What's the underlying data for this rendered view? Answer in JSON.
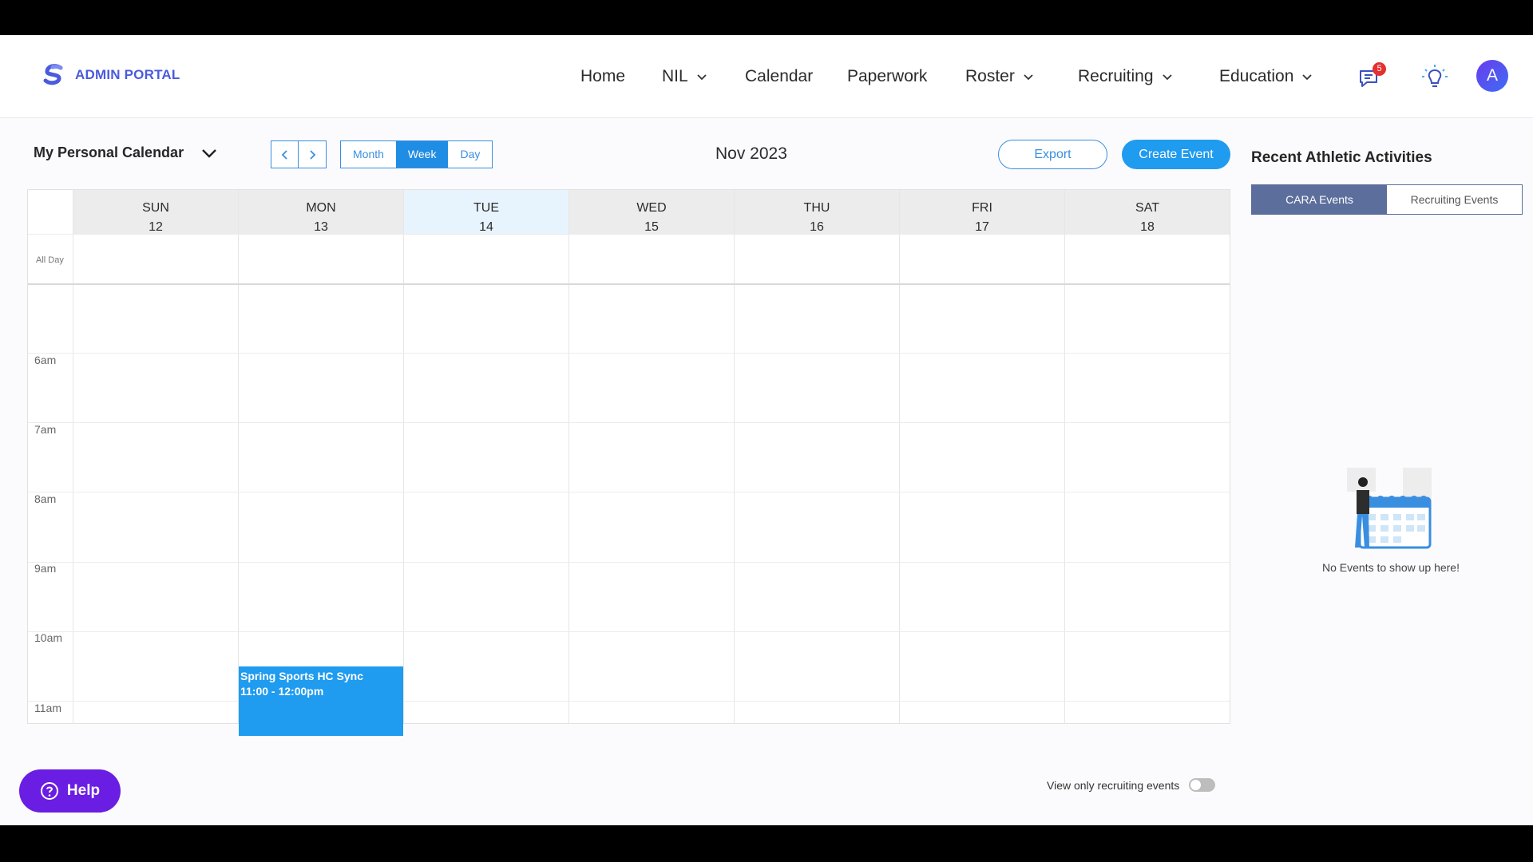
{
  "header": {
    "brand": "ADMIN PORTAL",
    "nav": [
      {
        "label": "Home",
        "dropdown": false
      },
      {
        "label": "NIL",
        "dropdown": true
      },
      {
        "label": "Calendar",
        "dropdown": false
      },
      {
        "label": "Paperwork",
        "dropdown": false
      },
      {
        "label": "Roster",
        "dropdown": true
      },
      {
        "label": "Recruiting",
        "dropdown": true
      },
      {
        "label": "Education",
        "dropdown": true
      }
    ],
    "messages_badge": "5",
    "avatar_initial": "A"
  },
  "toolbar": {
    "calendar_select": "My Personal Calendar",
    "views": [
      "Month",
      "Week",
      "Day"
    ],
    "active_view": "Week",
    "month_label": "Nov 2023",
    "export_label": "Export",
    "create_label": "Create Event"
  },
  "calendar": {
    "all_day_label": "All Day",
    "days": [
      {
        "name": "SUN",
        "date": "12"
      },
      {
        "name": "MON",
        "date": "13"
      },
      {
        "name": "TUE",
        "date": "14",
        "today": true
      },
      {
        "name": "WED",
        "date": "15"
      },
      {
        "name": "THU",
        "date": "16"
      },
      {
        "name": "FRI",
        "date": "17"
      },
      {
        "name": "SAT",
        "date": "18"
      }
    ],
    "times": [
      "6am",
      "7am",
      "8am",
      "9am",
      "10am",
      "11am"
    ],
    "event": {
      "title": "Spring Sports HC Sync",
      "time": "11:00 - 12:00pm"
    }
  },
  "footer": {
    "help_label": "Help",
    "toggle_label": "View only recruiting events"
  },
  "panel": {
    "title": "Recent Athletic Activities",
    "tabs": [
      "CARA Events",
      "Recruiting Events"
    ],
    "active_tab": "CARA Events",
    "empty_text": "No Events to show up here!"
  },
  "colors": {
    "accent": "#1f9bef",
    "help": "#6a1de3",
    "brand": "#4a5bdc",
    "tab_active": "#5c6e9c"
  }
}
